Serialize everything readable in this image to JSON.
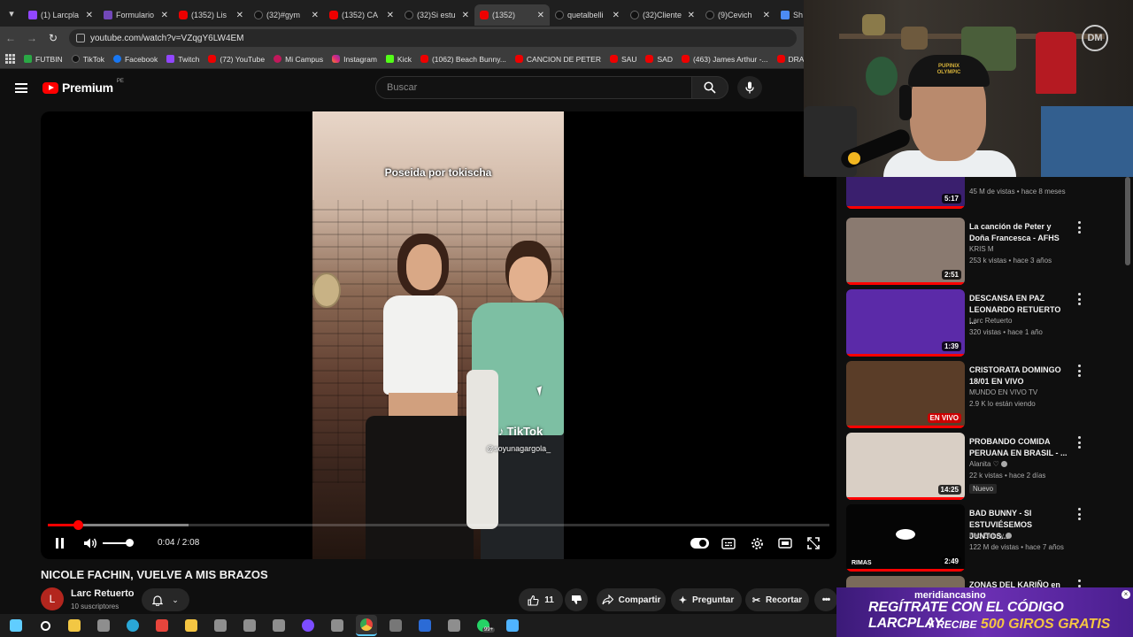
{
  "browser": {
    "tabs": [
      {
        "label": "(1) Larcpla",
        "icon": "twitch-icon",
        "active": false
      },
      {
        "label": "Formulario",
        "icon": "forms-icon",
        "active": false
      },
      {
        "label": "(1352) Lis",
        "icon": "youtube-icon",
        "active": false
      },
      {
        "label": "(32)#gym",
        "icon": "tiktok-icon",
        "active": false
      },
      {
        "label": "(1352) CA",
        "icon": "youtube-icon",
        "active": false
      },
      {
        "label": "(32)Si estu",
        "icon": "tiktok-icon",
        "active": false
      },
      {
        "label": "(1352)",
        "icon": "youtube-icon",
        "active": true
      },
      {
        "label": "quetalbelli",
        "icon": "tiktok-icon",
        "active": false
      },
      {
        "label": "(32)Cliente",
        "icon": "tiktok-icon",
        "active": false
      },
      {
        "label": "(9)Cevich",
        "icon": "tiktok-icon",
        "active": false
      },
      {
        "label": "Sh",
        "icon": "docs-icon",
        "active": false
      }
    ],
    "url": "youtube.com/watch?v=VZqgY6LW4EM",
    "bookmarks": [
      {
        "label": "FUTBIN",
        "icon": "futbin-icon"
      },
      {
        "label": "TikTok",
        "icon": "tiktok-icon"
      },
      {
        "label": "Facebook",
        "icon": "facebook-icon"
      },
      {
        "label": "Twitch",
        "icon": "twitch-icon"
      },
      {
        "label": "(72) YouTube",
        "icon": "youtube-icon"
      },
      {
        "label": "Mi Campus",
        "icon": "campus-icon"
      },
      {
        "label": "Instagram",
        "icon": "instagram-icon"
      },
      {
        "label": "Kick",
        "icon": "kick-icon"
      },
      {
        "label": "(1062) Beach Bunny...",
        "icon": "youtube-icon"
      },
      {
        "label": "CANCION DE PETER",
        "icon": "youtube-icon"
      },
      {
        "label": "SAU",
        "icon": "youtube-icon"
      },
      {
        "label": "SAD",
        "icon": "youtube-icon"
      },
      {
        "label": "(463) James Arthur -...",
        "icon": "youtube-icon"
      },
      {
        "label": "DRAGO",
        "icon": "youtube-icon"
      }
    ]
  },
  "youtube": {
    "logo_text": "Premium",
    "country_code": "PE",
    "search_placeholder": "Buscar"
  },
  "player": {
    "overlay_text": "Poseida por tokischa",
    "watermark": "TikTok",
    "watermark_handle": "@soyunagargola_",
    "time_display": "0:04 / 2:08",
    "progress": 0.038,
    "buffered": 0.18,
    "volume": 1.0
  },
  "video": {
    "title": "NICOLE FACHIN, VUELVE A MIS BRAZOS",
    "channel": "Larc Retuerto",
    "channel_initial": "L",
    "subscribers": "10 suscriptores",
    "likes": "11",
    "share_label": "Compartir",
    "ask_label": "Preguntar",
    "clip_label": "Recortar"
  },
  "webcam": {
    "cap_text": "PUPINIX OLYMPIC",
    "logo": "DM"
  },
  "recommendations": [
    {
      "title": "",
      "channel": "",
      "meta": "45 M de vistas • hace 8 meses",
      "duration": "5:17",
      "live": false,
      "new": false,
      "partial": true,
      "thumb_color": "#3a1f6e"
    },
    {
      "title": "La canción de Peter y Doña Francesca - AFHS",
      "channel": "KRIS M",
      "meta": "253 k vistas • hace 3 años",
      "duration": "2:51",
      "live": false,
      "new": false,
      "thumb_color": "#8a7a70"
    },
    {
      "title": "DESCANSA EN PAZ LEONARDO RETUERTO ...",
      "channel": "Larc Retuerto",
      "meta": "320 vistas • hace 1 año",
      "duration": "1:39",
      "live": false,
      "new": false,
      "thumb_color": "#5b2aa8"
    },
    {
      "title": "CRISTORATA DOMINGO 18/01 EN VIVO",
      "channel": "MUNDO EN VIVO TV",
      "meta": "2.9 K lo están viendo",
      "duration": "EN VIVO",
      "live": true,
      "new": false,
      "thumb_color": "#5a3d28"
    },
    {
      "title": "PROBANDO COMIDA PERUANA EN BRASIL - ...",
      "channel": "Alanita ♡",
      "meta": "22 k vistas • hace 2 días",
      "duration": "14:25",
      "live": false,
      "new": true,
      "new_label": "Nuevo",
      "thumb_color": "#d9cfc5"
    },
    {
      "title": "BAD BUNNY - SI ESTUVIÉSEMOS JUNTOS...",
      "channel": "Bad Bunny",
      "meta": "122 M de vistas • hace 7 años",
      "duration": "2:49",
      "live": false,
      "new": false,
      "thumb_label": "RIMAS",
      "thumb_color": "#050505"
    },
    {
      "title": "ZONAS DEL KARIÑO en",
      "channel": "",
      "meta": "",
      "duration": "",
      "live": false,
      "new": false,
      "partial": true,
      "thumb_color": "#7a6a5a"
    }
  ],
  "ad": {
    "brand": "meridiancasino",
    "line1_prefix": "REGÍTRATE CON EL CÓDIGO",
    "code": "LARCPLAY",
    "line2_prefix": "Y RECIBE",
    "line2_highlight": "500 GIROS GRATIS"
  },
  "taskbar": {
    "icons": [
      "windows-icon",
      "search-icon",
      "store-icon",
      "app-icon",
      "edge-icon",
      "media-icon",
      "explorer-icon",
      "app-icon",
      "app-icon",
      "app-icon",
      "discord-icon",
      "app-icon",
      "chrome-icon",
      "calculator-icon",
      "word-icon",
      "app-icon",
      "whatsapp-icon",
      "photos-icon"
    ],
    "whatsapp_badge": "99+"
  },
  "colors": {
    "accent": "#ff0000",
    "bg": "#0f0f0f",
    "chip": "#272727"
  }
}
